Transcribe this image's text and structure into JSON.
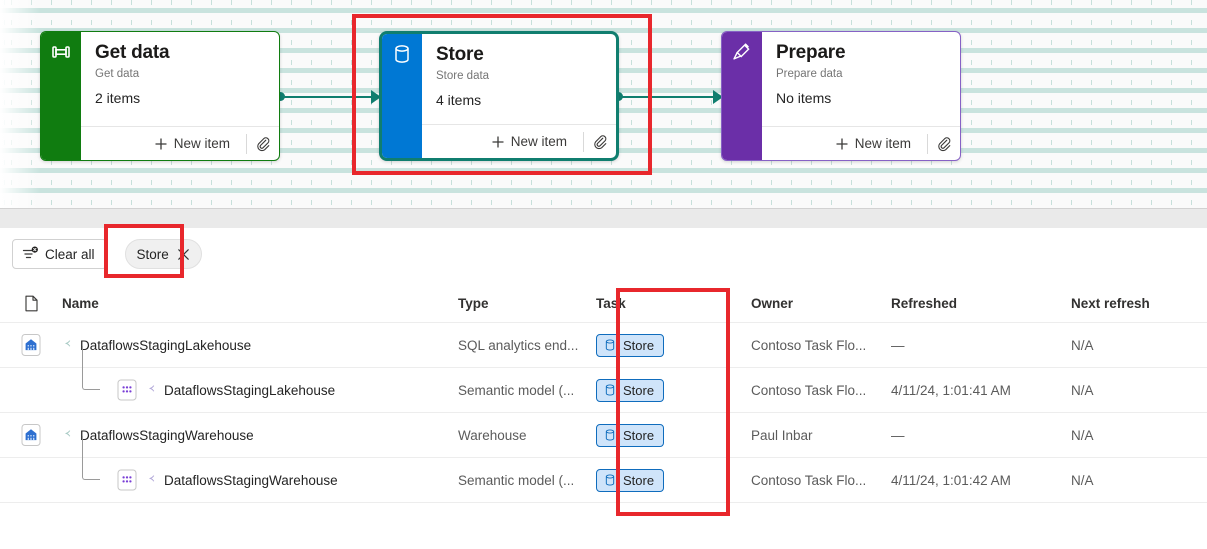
{
  "canvas": {
    "cards": [
      {
        "id": "getdata",
        "title": "Get data",
        "subtitle": "Get data",
        "count": "2 items",
        "new_item_label": "New item",
        "accent_color": "#107c10",
        "border_color": "#107c10",
        "icon": "get-data-icon",
        "selected": false
      },
      {
        "id": "store",
        "title": "Store",
        "subtitle": "Store data",
        "count": "4 items",
        "new_item_label": "New item",
        "accent_color": "#0078d4",
        "border_color": "#107e6f",
        "icon": "database-icon",
        "selected": true
      },
      {
        "id": "prepare",
        "title": "Prepare",
        "subtitle": "Prepare data",
        "count": "No items",
        "new_item_label": "New item",
        "accent_color": "#6b2fa8",
        "border_color": "#8661c5",
        "icon": "broom-icon",
        "selected": false
      }
    ],
    "connector_color": "#107e6f"
  },
  "filter_bar": {
    "clear_all_label": "Clear all",
    "clear_all_icon": "clear-filter-icon",
    "chips": [
      {
        "label": "Store",
        "remove_icon": "close-icon"
      }
    ]
  },
  "table": {
    "columns": [
      {
        "key": "icon",
        "label": "",
        "icon": "file-icon"
      },
      {
        "key": "name",
        "label": "Name"
      },
      {
        "key": "type",
        "label": "Type"
      },
      {
        "key": "task",
        "label": "Task"
      },
      {
        "key": "owner",
        "label": "Owner"
      },
      {
        "key": "refreshed",
        "label": "Refreshed"
      },
      {
        "key": "next_refresh",
        "label": "Next refresh"
      }
    ],
    "rows": [
      {
        "name": "DataflowsStagingLakehouse",
        "icon": "lakehouse-icon",
        "indented": false,
        "type": "SQL analytics end...",
        "task": "Store",
        "task_icon": "database-icon",
        "owner": "Contoso Task Flo...",
        "refreshed": "—",
        "next_refresh": "N/A"
      },
      {
        "name": "DataflowsStagingLakehouse",
        "icon": "semantic-model-icon",
        "indented": true,
        "type": "Semantic model (...",
        "task": "Store",
        "task_icon": "database-icon",
        "owner": "Contoso Task Flo...",
        "refreshed": "4/11/24, 1:01:41 AM",
        "next_refresh": "N/A"
      },
      {
        "name": "DataflowsStagingWarehouse",
        "icon": "warehouse-icon",
        "indented": false,
        "type": "Warehouse",
        "task": "Store",
        "task_icon": "database-icon",
        "owner": "Paul Inbar",
        "refreshed": "—",
        "next_refresh": "N/A"
      },
      {
        "name": "DataflowsStagingWarehouse",
        "icon": "semantic-model-icon",
        "indented": true,
        "type": "Semantic model (...",
        "task": "Store",
        "task_icon": "database-icon",
        "owner": "Contoso Task Flo...",
        "refreshed": "4/11/24, 1:01:42 AM",
        "next_refresh": "N/A"
      }
    ]
  },
  "annotations": {
    "highlight_color": "#e8272c",
    "boxes": [
      "store-card",
      "store-filter-chip",
      "task-column"
    ]
  }
}
